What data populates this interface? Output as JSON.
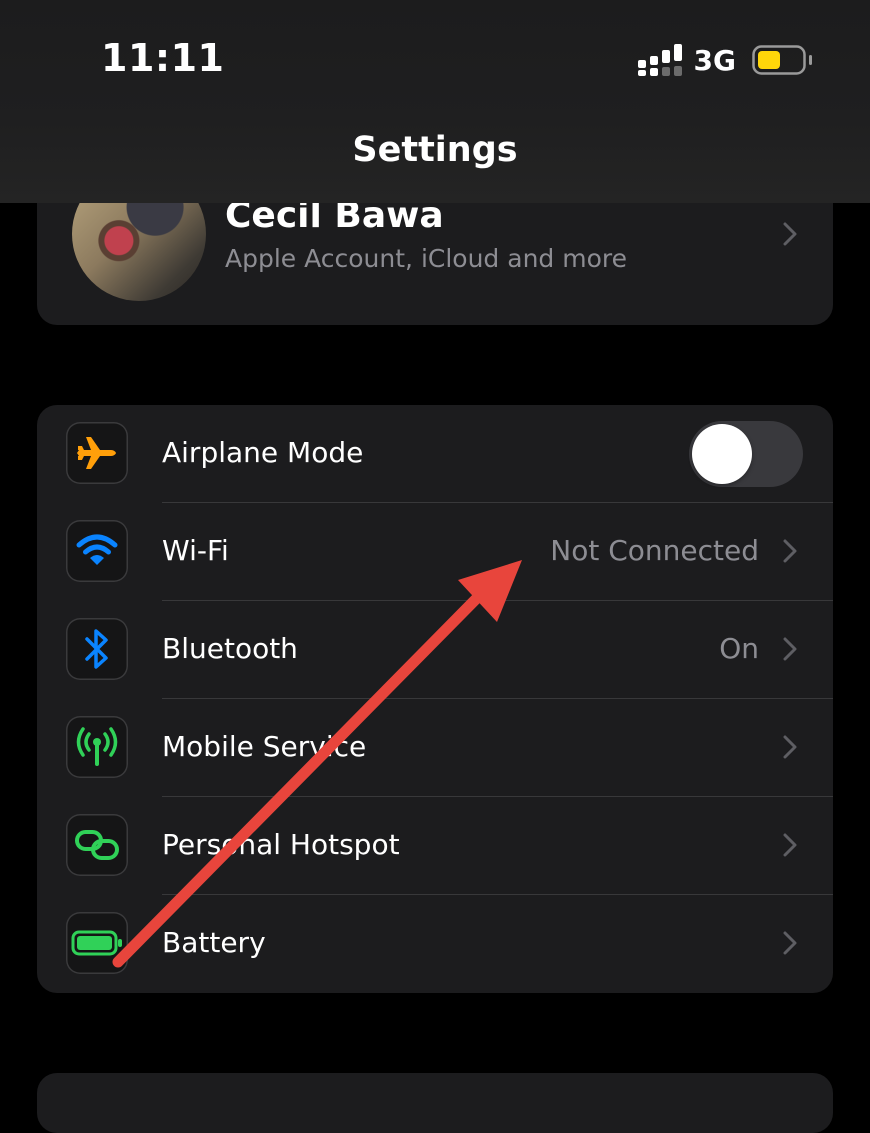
{
  "status_bar": {
    "time": "11:11",
    "network": "3G",
    "battery_color": "#ffd60a"
  },
  "nav": {
    "title": "Settings"
  },
  "profile": {
    "name": "Cecil Bawa",
    "subtitle": "Apple Account, iCloud and more"
  },
  "rows": [
    {
      "label": "Airplane Mode",
      "icon": "airplane-icon",
      "icon_color": "#ff9f0a",
      "toggle_on": false
    },
    {
      "label": "Wi-Fi",
      "value": "Not Connected",
      "icon": "wifi-icon",
      "icon_color": "#0a84ff"
    },
    {
      "label": "Bluetooth",
      "value": "On",
      "icon": "bluetooth-icon",
      "icon_color": "#0a84ff"
    },
    {
      "label": "Mobile Service",
      "icon": "antenna-icon",
      "icon_color": "#30d158"
    },
    {
      "label": "Personal Hotspot",
      "icon": "hotspot-link-icon",
      "icon_color": "#30d158"
    },
    {
      "label": "Battery",
      "icon": "battery-icon",
      "icon_color": "#30d158"
    }
  ],
  "annotation": {
    "arrow_color": "#e8453c"
  }
}
